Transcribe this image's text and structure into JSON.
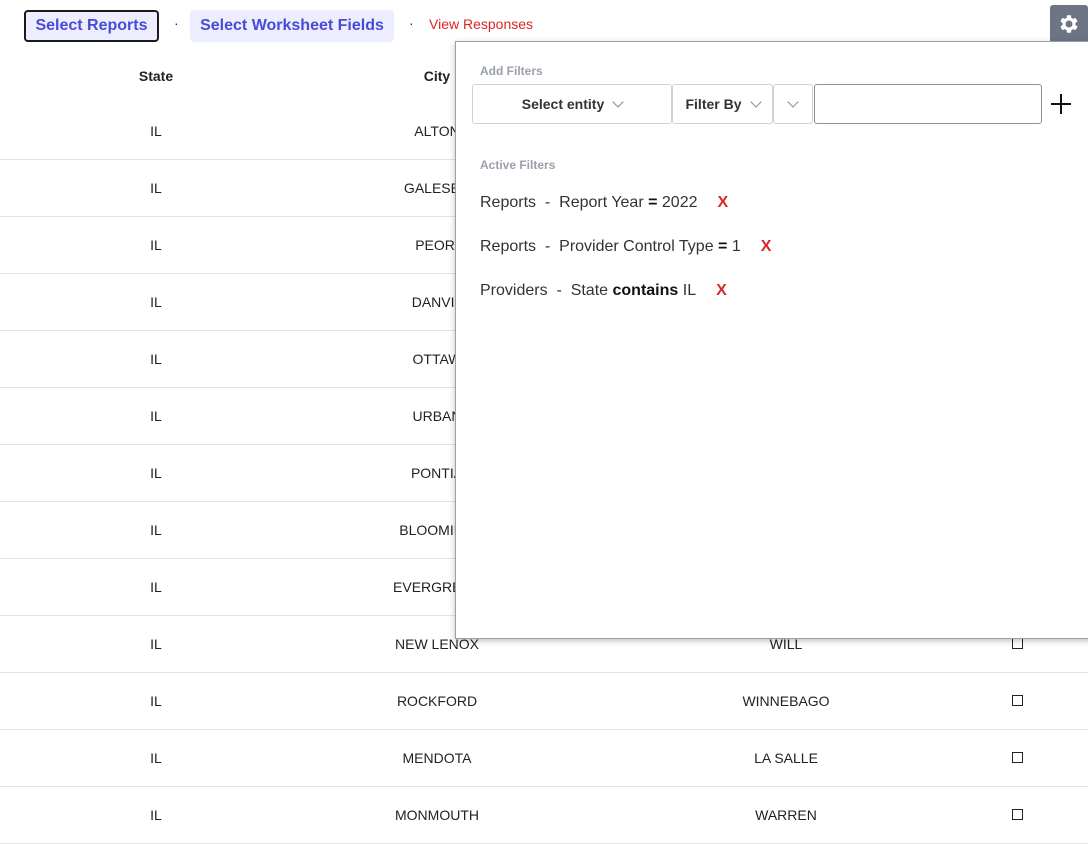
{
  "nav": {
    "select_reports": "Select Reports",
    "sep1": "·",
    "select_worksheet_fields": "Select Worksheet Fields",
    "sep2": "·",
    "view_responses": "View Responses",
    "settings_icon": "gear-icon"
  },
  "table": {
    "headers": {
      "state": "State",
      "city": "City"
    },
    "rows": [
      {
        "state": "IL",
        "city": "ALTON",
        "county": ""
      },
      {
        "state": "IL",
        "city": "GALESBU",
        "county": ""
      },
      {
        "state": "IL",
        "city": "PEORI",
        "county": ""
      },
      {
        "state": "IL",
        "city": "DANVIL",
        "county": ""
      },
      {
        "state": "IL",
        "city": "OTTAW",
        "county": ""
      },
      {
        "state": "IL",
        "city": "URBAN",
        "county": ""
      },
      {
        "state": "IL",
        "city": "PONTIA",
        "county": ""
      },
      {
        "state": "IL",
        "city": "BLOOMING",
        "county": ""
      },
      {
        "state": "IL",
        "city": "EVERGREEN",
        "county": ""
      },
      {
        "state": "IL",
        "city": "NEW LENOX",
        "county": "WILL"
      },
      {
        "state": "IL",
        "city": "ROCKFORD",
        "county": "WINNEBAGO"
      },
      {
        "state": "IL",
        "city": "MENDOTA",
        "county": "LA SALLE"
      },
      {
        "state": "IL",
        "city": "MONMOUTH",
        "county": "WARREN"
      }
    ]
  },
  "filter_panel": {
    "add_filters_label": "Add Filters",
    "entity_select": "Select entity",
    "filter_by_select": "Filter By",
    "value_placeholder": "",
    "active_filters_label": "Active Filters",
    "active_filters": [
      {
        "entity": "Reports",
        "field": "Report Year",
        "operator": "=",
        "value": "2022",
        "remove": "X"
      },
      {
        "entity": "Reports",
        "field": "Provider Control Type",
        "operator": "=",
        "value": "1",
        "remove": "X"
      },
      {
        "entity": "Providers",
        "field": "State",
        "operator": "contains",
        "value": "IL",
        "remove": "X"
      }
    ]
  }
}
